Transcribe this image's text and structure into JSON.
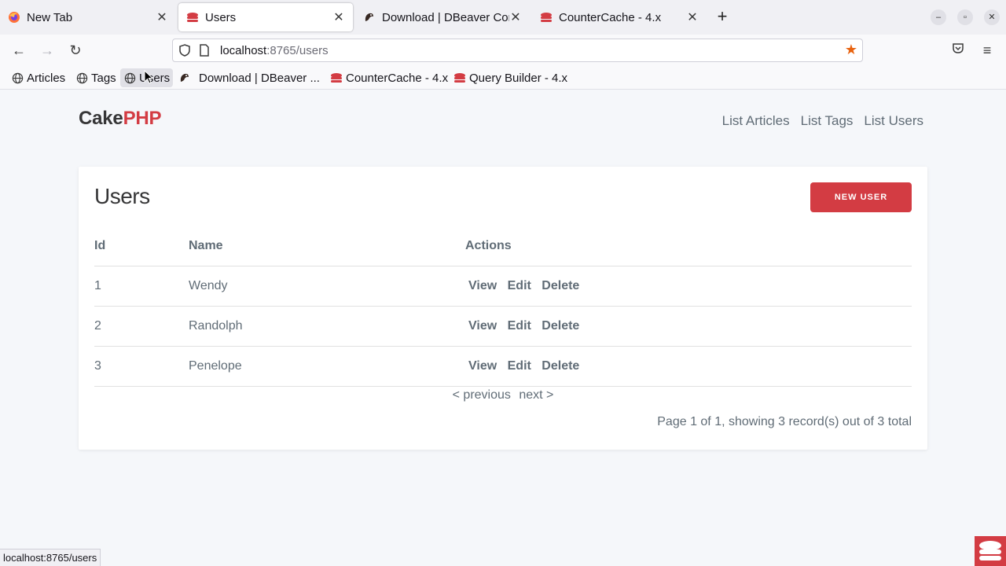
{
  "browser": {
    "tabs": [
      {
        "title": "New Tab",
        "icon": "firefox-icon",
        "active": false
      },
      {
        "title": "Users",
        "icon": "cakephp-icon",
        "active": true
      },
      {
        "title": "Download | DBeaver Com",
        "icon": "dbeaver-icon",
        "active": false
      },
      {
        "title": "CounterCache - 4.x",
        "icon": "cakephp-icon",
        "active": false
      }
    ],
    "url_host": "localhost",
    "url_path": ":8765/users",
    "bookmarks": [
      {
        "label": "Articles",
        "icon": "globe-icon"
      },
      {
        "label": "Tags",
        "icon": "globe-icon"
      },
      {
        "label": "Users",
        "icon": "globe-icon"
      },
      {
        "label": "Download | DBeaver ...",
        "icon": "dbeaver-icon"
      },
      {
        "label": "CounterCache - 4.x",
        "icon": "cakephp-icon"
      },
      {
        "label": "Query Builder - 4.x",
        "icon": "cakephp-icon"
      }
    ],
    "status_url": "localhost:8765/users"
  },
  "app": {
    "brand_cake": "Cake",
    "brand_php": "PHP",
    "nav": [
      "List Articles",
      "List Tags",
      "List Users"
    ],
    "page_title": "Users",
    "new_button": "NEW USER",
    "columns": [
      "Id",
      "Name",
      "Actions"
    ],
    "rows": [
      {
        "id": "1",
        "name": "Wendy"
      },
      {
        "id": "2",
        "name": "Randolph"
      },
      {
        "id": "3",
        "name": "Penelope"
      }
    ],
    "actions": [
      "View",
      "Edit",
      "Delete"
    ],
    "pager_prev": "< previous",
    "pager_next": "next >",
    "page_count": "Page 1 of 1, showing 3 record(s) out of 3 total"
  },
  "colors": {
    "accent": "#d33c43",
    "text": "#606c76"
  }
}
